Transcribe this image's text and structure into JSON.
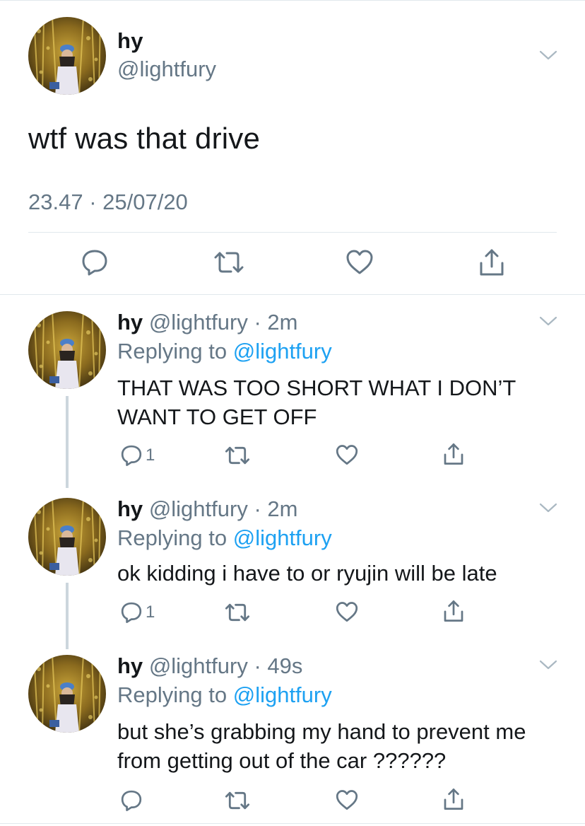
{
  "main_tweet": {
    "name": "hy",
    "handle": "@lightfury",
    "text": "wtf was that drive",
    "timestamp": "23.47 · 25/07/20",
    "actions": [
      "reply-icon",
      "retweet-icon",
      "like-icon",
      "share-icon"
    ]
  },
  "replies": [
    {
      "name": "hy",
      "handle": "@lightfury",
      "dot": "·",
      "time": "2m",
      "replying_prefix": "Replying to ",
      "replying_to": "@lightfury",
      "text": "THAT WAS TOO SHORT WHAT I DON’T WANT TO GET OFF",
      "reply_count": "1"
    },
    {
      "name": "hy",
      "handle": "@lightfury",
      "dot": "·",
      "time": "2m",
      "replying_prefix": "Replying to ",
      "replying_to": "@lightfury",
      "text": "ok kidding i have to or ryujin will be late",
      "reply_count": "1"
    },
    {
      "name": "hy",
      "handle": "@lightfury",
      "dot": "·",
      "time": "49s",
      "replying_prefix": "Replying to ",
      "replying_to": "@lightfury",
      "text": "but she’s grabbing my hand to prevent me from getting out of the car ??????",
      "reply_count": ""
    }
  ],
  "colors": {
    "text": "#14171a",
    "secondary": "#657786",
    "link": "#1da1f2",
    "divider": "#e1e8ed",
    "thread_line": "#ccd6dd"
  }
}
